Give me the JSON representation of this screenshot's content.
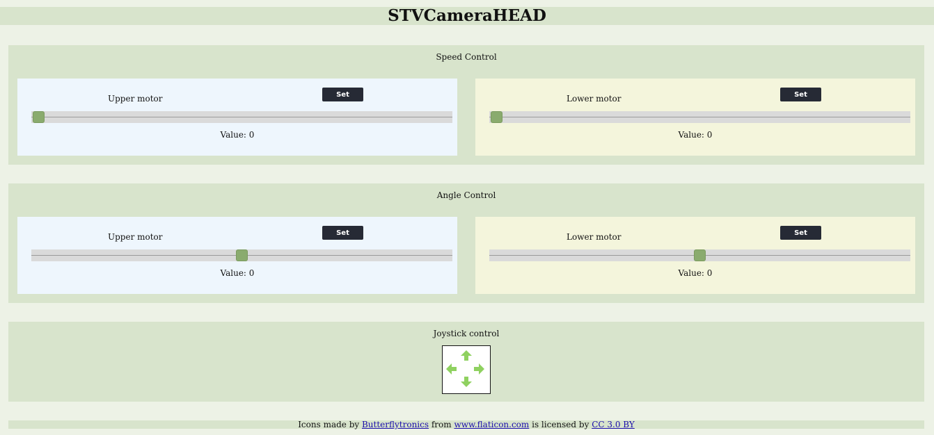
{
  "page": {
    "title": "STVCameraHEAD"
  },
  "speed": {
    "title": "Speed Control",
    "upper": {
      "label": "Upper motor",
      "set": "Set",
      "value_label": "Value: 0",
      "level": 0
    },
    "lower": {
      "label": "Lower motor",
      "set": "Set",
      "value_label": "Value: 0",
      "level": 0
    }
  },
  "angle": {
    "title": "Angle Control",
    "upper": {
      "label": "Upper motor",
      "set": "Set",
      "value_label": "Value: 0",
      "level": 0.5
    },
    "lower": {
      "label": "Lower motor",
      "set": "Set",
      "value_label": "Value: 0",
      "level": 0.5
    }
  },
  "joystick": {
    "title": "Joystick control",
    "arrows": [
      "arrow-up-icon",
      "arrow-left-icon",
      "arrow-right-icon",
      "arrow-down-icon"
    ],
    "arrow_color": "#8fd160"
  },
  "footer": {
    "prefix": "Icons made by ",
    "author": "Butterflytronics",
    "from": " from ",
    "site": "www.flaticon.com",
    "licensed": " is licensed by ",
    "license": "CC 3.0 BY"
  },
  "colors": {
    "page_bg": "#edf2e6",
    "panel_bg": "#d8e4cc",
    "upper_card": "#eef6fd",
    "lower_card": "#f4f5dc",
    "button_bg": "#262a35",
    "thumb": "#8aab6e"
  }
}
